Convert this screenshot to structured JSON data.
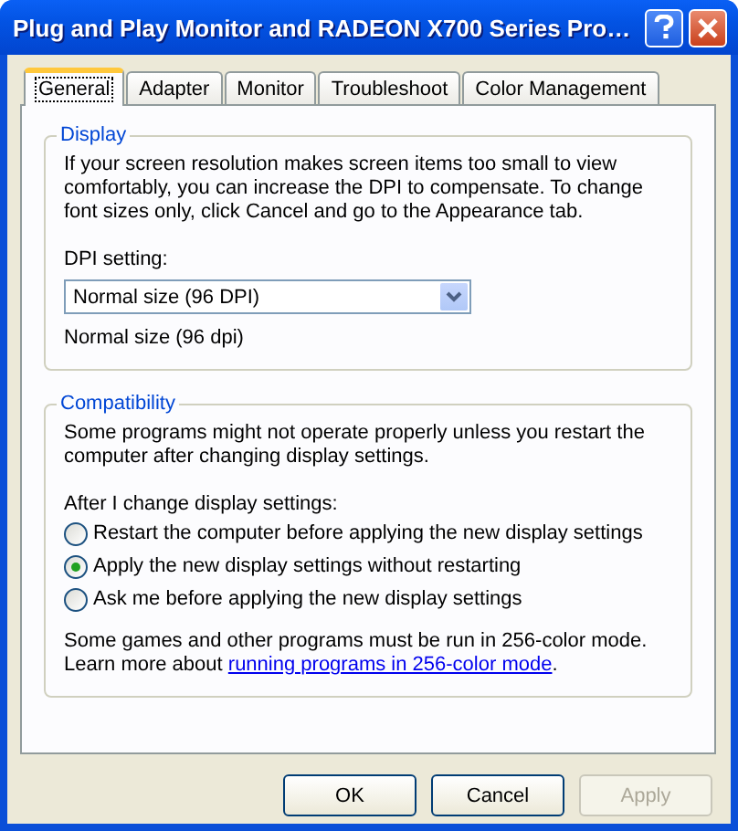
{
  "window": {
    "title": "Plug and Play Monitor and RADEON X700 Series Pro…"
  },
  "tabs": [
    {
      "label": "General",
      "selected": true
    },
    {
      "label": "Adapter",
      "selected": false
    },
    {
      "label": "Monitor",
      "selected": false
    },
    {
      "label": "Troubleshoot",
      "selected": false
    },
    {
      "label": "Color Management",
      "selected": false
    }
  ],
  "display": {
    "title": "Display",
    "description": "If your screen resolution makes screen items too small to view comfortably, you can increase the DPI to compensate.  To change font sizes only, click Cancel and go to the Appearance tab.",
    "dpi_label": "DPI setting:",
    "dpi_value": "Normal size (96 DPI)",
    "dpi_note": "Normal size (96 dpi)"
  },
  "compatibility": {
    "title": "Compatibility",
    "description": "Some programs might not operate properly unless you restart the computer after changing display settings.",
    "prompt": "After I change display settings:",
    "options": [
      {
        "label": "Restart the computer before applying the new display settings",
        "selected": false
      },
      {
        "label": "Apply the new display settings without restarting",
        "selected": true
      },
      {
        "label": "Ask me before applying the new display settings",
        "selected": false
      }
    ],
    "note": "Some games and other programs must be run in 256-color mode.",
    "learn_prefix": "Learn more about",
    "link": "running programs in 256-color mode",
    "learn_suffix": "."
  },
  "buttons": [
    {
      "label": "OK",
      "disabled": false
    },
    {
      "label": "Cancel",
      "disabled": false
    },
    {
      "label": "Apply",
      "disabled": true
    }
  ]
}
